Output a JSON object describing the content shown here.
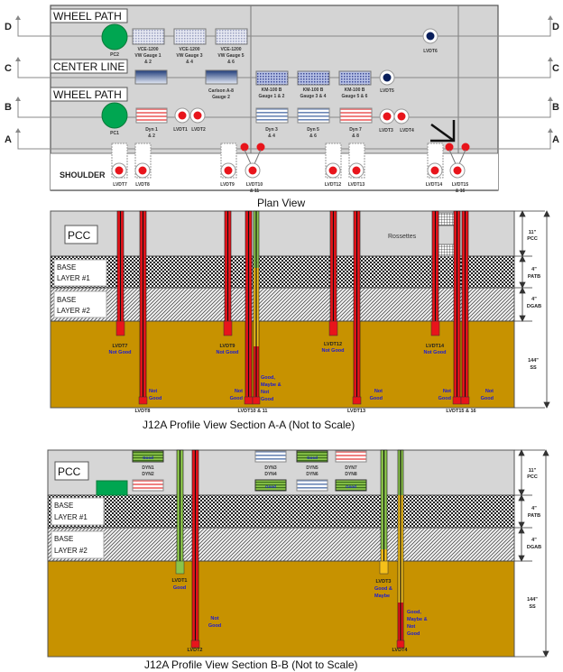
{
  "plan_view": {
    "title": "Plan View",
    "section_letters_left": [
      "D",
      "C",
      "B",
      "A"
    ],
    "section_letters_right": [
      "D",
      "C",
      "B",
      "A"
    ],
    "zone_labels": {
      "wheel_path_top": "WHEEL PATH",
      "center_line": "CENTER LINE",
      "wheel_path_bottom": "WHEEL PATH",
      "shoulder": "SHOULDER"
    },
    "sensors": {
      "pc2": "PC2",
      "pc1": "PC1",
      "vce1_l1": "VCE-1200",
      "vce1_l2": "VW Gauge 1",
      "vce1_l3": "& 2",
      "vce2_l1": "VCE-1200",
      "vce2_l2": "VW Gauge 3",
      "vce2_l3": "& 4",
      "vce3_l1": "VCE-1200",
      "vce3_l2": "VW Gauge 5",
      "vce3_l3": "& 6",
      "carlson_l1": "Carlson A-8",
      "carlson_l2": "Gauge 2",
      "km1_l1": "KM-100 B",
      "km1_l2": "Gauge 1 & 2",
      "km2_l1": "KM-100 B",
      "km2_l2": "Gauge 3 & 4",
      "km3_l1": "KM-100 B",
      "km3_l2": "Gauge 5 & 6",
      "lvdt5": "LVDT5",
      "lvdt6": "LVDT6",
      "dyn12_l1": "Dyn 1",
      "dyn12_l2": "& 2",
      "dyn34_l1": "Dyn 3",
      "dyn34_l2": "& 4",
      "dyn56_l1": "Dyn 5",
      "dyn56_l2": "& 6",
      "dyn78_l1": "Dyn 7",
      "dyn78_l2": "& 8",
      "lvdt1": "LVDT1",
      "lvdt2": "LVDT2",
      "lvdt3": "LVDT3",
      "lvdt4": "LVDT4",
      "lvdt7": "LVDT7",
      "lvdt8": "LVDT8",
      "lvdt9": "LVDT9",
      "lvdt10_l1": "LVDT10",
      "lvdt10_l2": "& 11",
      "lvdt12": "LVDT12",
      "lvdt13": "LVDT13",
      "lvdt14": "LVDT14",
      "lvdt15_l1": "LVDT15",
      "lvdt15_l2": "& 16"
    }
  },
  "section_aa": {
    "title": "J12A Profile View Section A-A (Not to Scale)",
    "layers": {
      "pcc": "PCC",
      "base1_l1": "BASE",
      "base1_l2": "LAYER #1",
      "base2_l1": "BASE",
      "base2_l2": "LAYER #2"
    },
    "rossettes": "Rossettes",
    "dimensions": {
      "pcc_l1": "11\"",
      "pcc_l2": "PCC",
      "patb_l1": "4\"",
      "patb_l2": "PATB",
      "dgab_l1": "4\"",
      "dgab_l2": "DGAB",
      "ss_l1": "144\"",
      "ss_l2": "SS"
    },
    "labels": {
      "lvdt7": "LVDT7",
      "lvdt7_status": "Not Good",
      "lvdt8": "LVDT8",
      "lvdt8_status_l1": "Not",
      "lvdt8_status_l2": "Good",
      "lvdt9": "LVDT9",
      "lvdt9_status": "Not Good",
      "lvdt10": "LVDT10 & 11",
      "lvdt10_status_l1": "Not",
      "lvdt10_status_l2": "Good",
      "lvdt11_status_l1": "Good,",
      "lvdt11_status_l2": "Maybe &",
      "lvdt11_status_l3": "Not",
      "lvdt11_status_l4": "Good",
      "lvdt12": "LVDT12",
      "lvdt12_status": "Not Good",
      "lvdt13": "LVDT13",
      "lvdt13_status_l1": "Not",
      "lvdt13_status_l2": "Good",
      "lvdt14": "LVDT14",
      "lvdt14_status": "Not Good",
      "lvdt15": "LVDT15 & 16",
      "lvdt15_status_l1": "Not",
      "lvdt15_status_l2": "Good",
      "lvdt16_status_l1": "Not",
      "lvdt16_status_l2": "Good"
    }
  },
  "section_bb": {
    "title": "J12A Profile View Section B-B (Not to Scale)",
    "layers": {
      "pcc": "PCC",
      "base1_l1": "BASE",
      "base1_l2": "LAYER #1",
      "base2_l1": "BASE",
      "base2_l2": "LAYER #2"
    },
    "dimensions": {
      "pcc_l1": "11\"",
      "pcc_l2": "PCC",
      "patb_l1": "4\"",
      "patb_l2": "PATB",
      "dgab_l1": "4\"",
      "dgab_l2": "DGAB",
      "ss_l1": "144\"",
      "ss_l2": "SS"
    },
    "dyn": {
      "dyn12_l1": "DYN1",
      "dyn12_l2": "DYN2",
      "dyn34_l1": "DYN3",
      "dyn34_l2": "DYN4",
      "dyn56_l1": "DYN5",
      "dyn56_l2": "DYN6",
      "dyn78_l1": "DYN7",
      "dyn78_l2": "DYN8",
      "good": "Good"
    },
    "labels": {
      "lvdt1": "LVDT1",
      "lvdt1_status": "Good",
      "lvdt2": "LVDT2",
      "lvdt2_status_l1": "Not",
      "lvdt2_status_l2": "Good",
      "lvdt3": "LVDT3",
      "lvdt3_status_l1": "Good &",
      "lvdt3_status_l2": "Maybe",
      "lvdt4": "LVDT4",
      "lvdt4_status_l1": "Good,",
      "lvdt4_status_l2": "Maybe &",
      "lvdt4_status_l3": "Not",
      "lvdt4_status_l4": "Good"
    }
  },
  "colors": {
    "good": "#8ac44a",
    "maybe": "#f5c01a",
    "not_good": "#e8141b",
    "subgrade": "#c79200",
    "pcc": "#d6d6d6",
    "status_text": "#1a1ad6",
    "pc_gauge": "#00a651"
  }
}
